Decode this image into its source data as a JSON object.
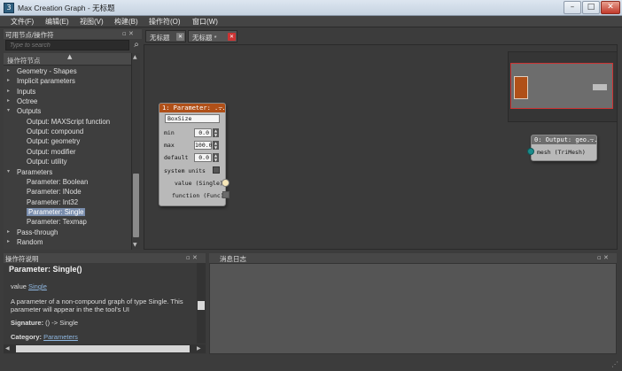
{
  "window": {
    "title": "Max Creation Graph - 无标题",
    "controls": {
      "min": "–",
      "max": "□",
      "close": "✕"
    }
  },
  "menu": [
    {
      "label": "文件(F)"
    },
    {
      "label": "编辑(E)"
    },
    {
      "label": "视图(V)"
    },
    {
      "label": "构建(B)"
    },
    {
      "label": "操作符(O)"
    },
    {
      "label": "窗口(W)"
    }
  ],
  "left_panel": {
    "title": "可用节点/操作符",
    "search_placeholder": "Type to search",
    "list_header": "操作符节点",
    "items": [
      {
        "label": "Geometry - Shapes",
        "indent": 0,
        "expander": "▸"
      },
      {
        "label": "Implicit parameters",
        "indent": 0,
        "expander": "▸"
      },
      {
        "label": "Inputs",
        "indent": 0,
        "expander": "▸"
      },
      {
        "label": "Octree",
        "indent": 0,
        "expander": "▸"
      },
      {
        "label": "Outputs",
        "indent": 0,
        "expander": "▾"
      },
      {
        "label": "Output: MAXScript function",
        "indent": 1
      },
      {
        "label": "Output: compound",
        "indent": 1
      },
      {
        "label": "Output: geometry",
        "indent": 1
      },
      {
        "label": "Output: modifier",
        "indent": 1
      },
      {
        "label": "Output: utility",
        "indent": 1
      },
      {
        "label": "Parameters",
        "indent": 0,
        "expander": "▾"
      },
      {
        "label": "Parameter: Boolean",
        "indent": 1
      },
      {
        "label": "Parameter: INode",
        "indent": 1
      },
      {
        "label": "Parameter: Int32",
        "indent": 1
      },
      {
        "label": "Parameter: Single",
        "indent": 1,
        "selected": true
      },
      {
        "label": "Parameter: Texmap",
        "indent": 1
      },
      {
        "label": "Pass-through",
        "indent": 0,
        "expander": "▸"
      },
      {
        "label": "Random",
        "indent": 0,
        "expander": "▸"
      }
    ]
  },
  "description": {
    "title": "操作符说明",
    "heading": "Parameter: Single()",
    "value_prefix": "value ",
    "value_link": "Single",
    "text_line1": "A parameter of a non-compound graph of type Single. This",
    "text_line2": "parameter will appear in the the tool's UI",
    "signature_label": "Signature:",
    "signature_value": " () -> Single",
    "category_label": "Category:",
    "category_link": "Parameters"
  },
  "tabs": [
    {
      "label": "无标题",
      "close": "✕",
      "close_color": "#777777"
    },
    {
      "label": "无标题 *",
      "close": "✕",
      "close_color": "#cc3333"
    }
  ],
  "nodes": {
    "param": {
      "title": "1: Parameter: ...",
      "header_color": "#b05018",
      "name_value": "BoxSize",
      "min_label": "min",
      "min_value": "0.0",
      "max_label": "max",
      "max_value": "100.0",
      "default_label": "default",
      "default_value": "0.0",
      "system_units_label": "system units",
      "value_output": "value (Single)",
      "function_output": "function (Func)"
    },
    "output": {
      "title": "0: Output: geo...",
      "header_color": "#6e6e6e",
      "mesh_input": "mesh (TriMesh)"
    }
  },
  "log_panel": {
    "title": "消息日志"
  },
  "panel_icons": "▫ ✕"
}
